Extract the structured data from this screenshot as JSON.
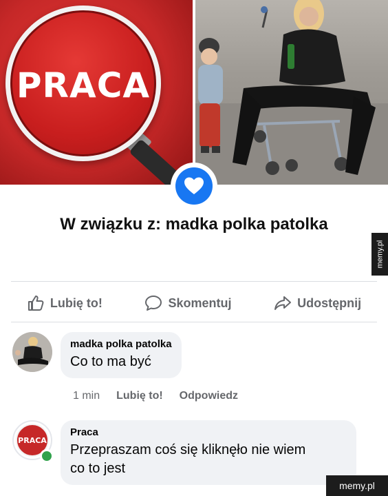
{
  "banner": {
    "left_logo_text": "PRACA",
    "accent_red": "#c62828",
    "heart_badge_color": "#1877f2",
    "heart_icon": "heart-icon"
  },
  "relationship": {
    "prefix": "W związku z:",
    "name": "madka polka patolka"
  },
  "actions": {
    "like_label": "Lubię to!",
    "comment_label": "Skomentuj",
    "share_label": "Udostępnij"
  },
  "comments": [
    {
      "author": "madka polka patolka",
      "text": "Co to ma być",
      "time": "1 min",
      "like_label": "Lubię to!",
      "reply_label": "Odpowiedz"
    },
    {
      "author": "Praca",
      "avatar_text": "PRACA",
      "text_line1": "Przepraszam coś się kliknęło nie wiem",
      "text_line2": "co to jest",
      "online_color": "#31a24c"
    }
  ],
  "watermarks": {
    "side": "memy.pl",
    "corner": "memy.pl"
  }
}
